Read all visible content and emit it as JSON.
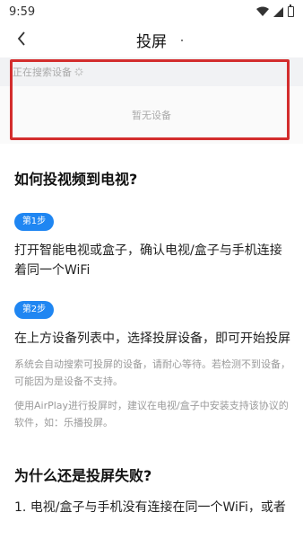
{
  "status": {
    "time": "9:59"
  },
  "nav": {
    "title": "投屏"
  },
  "device_list": {
    "searching_text": "正在搜索设备",
    "empty_text": "暂无设备"
  },
  "guide": {
    "title": "如何投视频到电视?",
    "steps": [
      {
        "badge": "第1步",
        "text": "打开智能电视或盒子，确认电视/盒子与手机连接着同一个WiFi"
      },
      {
        "badge": "第2步",
        "text": "在上方设备列表中，选择投屏设备，即可开始投屏"
      }
    ],
    "notes": [
      "系统会自动搜索可投屏的设备，请耐心等待。若检测不到设备，可能因为是设备不支持。",
      "使用AirPlay进行投屏时，建议在电视/盒子中安装支持该协议的软件，如：乐播投屏。"
    ]
  },
  "failure": {
    "title": "为什么还是投屏失败?",
    "items": [
      "1. 电视/盒子与手机没有连接在同一个WiFi，或者"
    ]
  },
  "colors": {
    "accent": "#1f86f2",
    "highlight": "#d32d2d"
  }
}
